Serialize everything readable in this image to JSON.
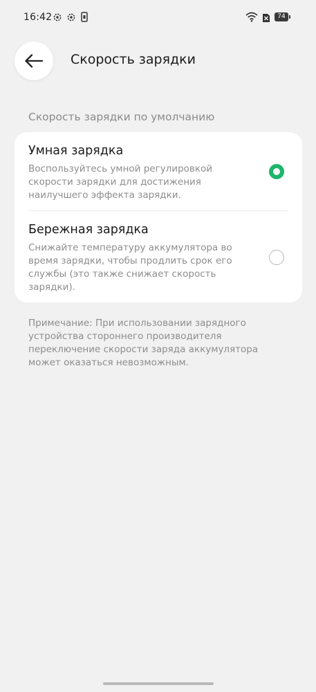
{
  "status_bar": {
    "time": "16:42",
    "battery": "74",
    "icons": [
      "settings-gear-icon",
      "settings-gear-icon",
      "phone-storage-icon",
      "wifi-icon",
      "no-sim-icon",
      "battery-icon"
    ]
  },
  "header": {
    "title": "Скорость зарядки",
    "back_icon": "arrow-left-icon"
  },
  "section": {
    "title": "Скорость зарядки по умолчанию"
  },
  "options": [
    {
      "title": "Умная зарядка",
      "description": "Воспользуйтесь умной регулировкой скорости зарядки для достижения наилучшего эффекта зарядки.",
      "selected": true
    },
    {
      "title": "Бережная зарядка",
      "description": "Снижайте температуру аккумулятора во время зарядки, чтобы продлить срок его службы (это также снижает скорость зарядки).",
      "selected": false
    }
  ],
  "note": "Примечание: При использовании зарядного устройства стороннего производителя переключение скорости заряда аккумулятора может оказаться невозможным.",
  "colors": {
    "accent": "#1db66a",
    "background": "#f1f1f1",
    "card": "#ffffff",
    "secondary_text": "#8d8d8d"
  }
}
